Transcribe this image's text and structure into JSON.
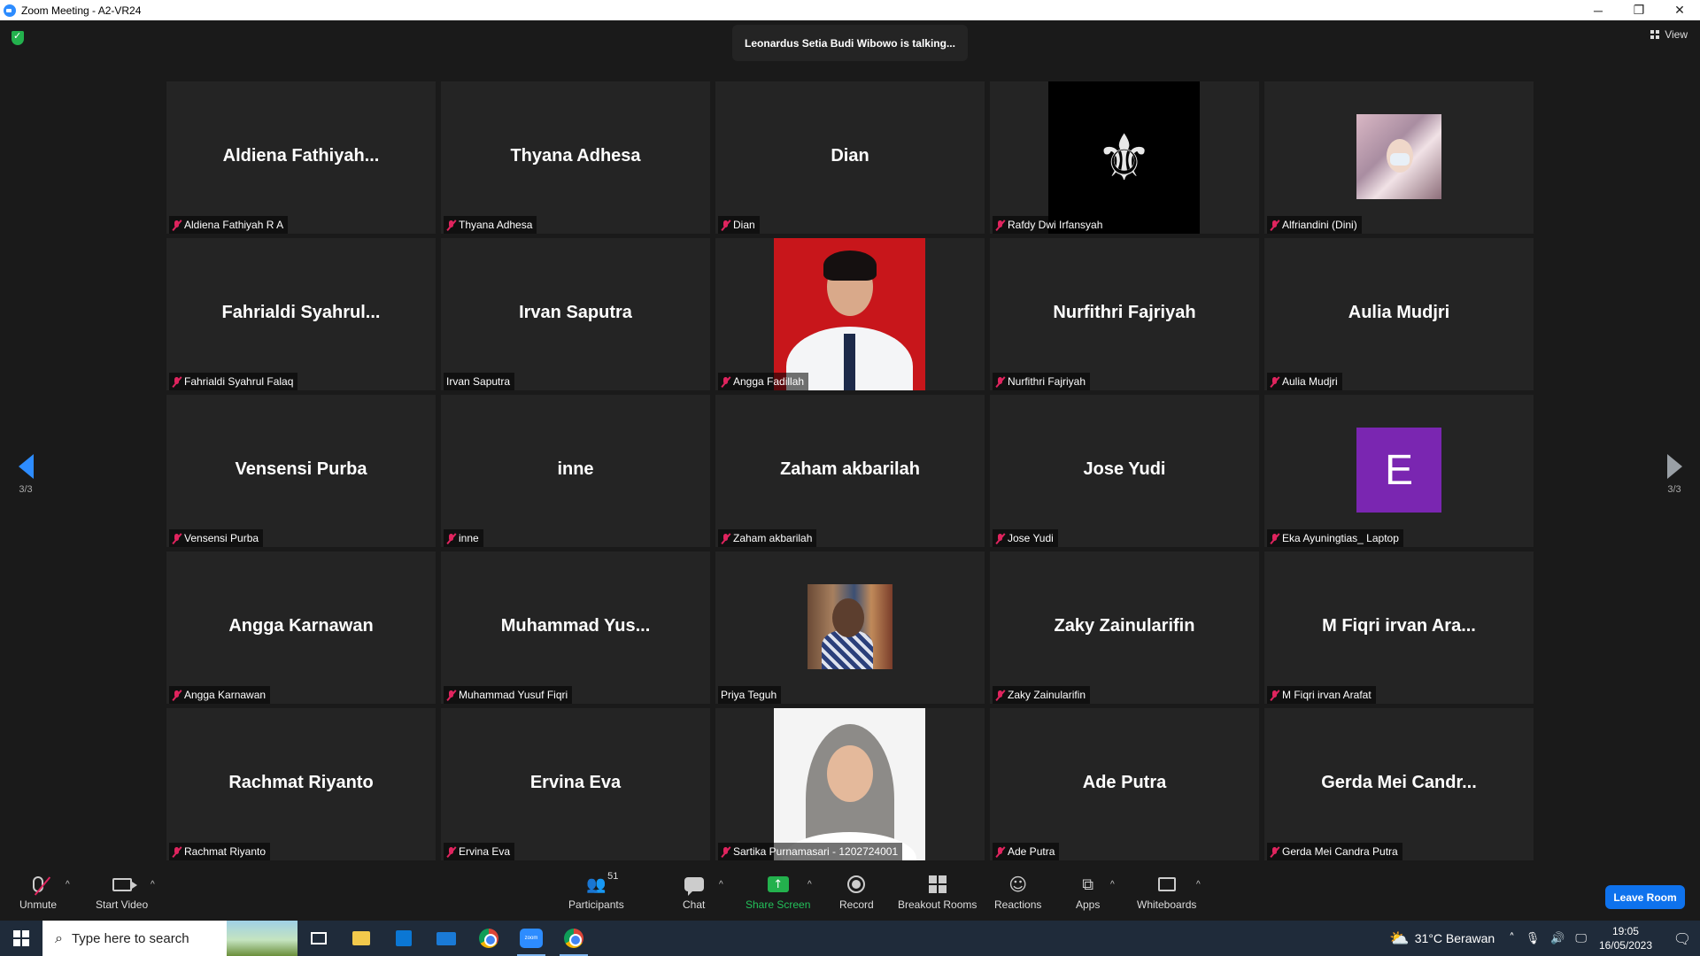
{
  "window": {
    "title": "Zoom Meeting - A2-VR24",
    "controls": [
      "─",
      "❐",
      "✕"
    ]
  },
  "meeting": {
    "talking": "Leonardus Setia Budi Wibowo is talking...",
    "view_label": "View",
    "page_left": "3/3",
    "page_right": "3/3"
  },
  "tiles": [
    {
      "big": "Aldiena  Fathiyah...",
      "label": "Aldiena Fathiyah R A",
      "muted": true
    },
    {
      "big": "Thyana Adhesa",
      "label": "Thyana Adhesa",
      "muted": true
    },
    {
      "big": "Dian",
      "label": "Dian",
      "muted": true
    },
    {
      "big": "",
      "label": "Rafdy Dwi Irfansyah",
      "muted": true,
      "media": "logo"
    },
    {
      "big": "",
      "label": "Alfriandini (Dini)",
      "muted": true,
      "media": "avatar-photo"
    },
    {
      "big": "Fahrialdi  Syahrul...",
      "label": "Fahrialdi Syahrul Falaq",
      "muted": true
    },
    {
      "big": "Irvan Saputra",
      "label": "Irvan Saputra",
      "muted": false
    },
    {
      "big": "",
      "label": "Angga Fadillah",
      "muted": true,
      "media": "red-portrait"
    },
    {
      "big": "Nurfithri Fajriyah",
      "label": "Nurfithri Fajriyah",
      "muted": true
    },
    {
      "big": "Aulia Mudjri",
      "label": "Aulia Mudjri",
      "muted": true
    },
    {
      "big": "Vensensi Purba",
      "label": "Vensensi Purba",
      "muted": true
    },
    {
      "big": "inne",
      "label": "inne",
      "muted": true
    },
    {
      "big": "Zaham akbarilah",
      "label": "Zaham akbarilah",
      "muted": true
    },
    {
      "big": "Jose Yudi",
      "label": "Jose Yudi",
      "muted": true
    },
    {
      "big": "",
      "label": "Eka Ayuningtias_ Laptop",
      "muted": true,
      "media": "letter-avatar",
      "letter": "E"
    },
    {
      "big": "Angga Karnawan",
      "label": "Angga Karnawan",
      "muted": true
    },
    {
      "big": "Muhammad  Yus...",
      "label": "Muhammad Yusuf Fiqri",
      "muted": true
    },
    {
      "big": "",
      "label": "Priya Teguh",
      "muted": false,
      "media": "small-photo"
    },
    {
      "big": "Zaky Zainularifin",
      "label": "Zaky Zainularifin",
      "muted": true
    },
    {
      "big": "M Fiqri irvan Ara...",
      "label": "M Fiqri irvan Arafat",
      "muted": true
    },
    {
      "big": "Rachmat Riyanto",
      "label": "Rachmat Riyanto",
      "muted": true
    },
    {
      "big": "Ervina Eva",
      "label": "Ervina Eva",
      "muted": true
    },
    {
      "big": "",
      "label": "Sartika Purnamasari - 1202724001",
      "muted": true,
      "media": "hijab-portrait"
    },
    {
      "big": "Ade Putra",
      "label": "Ade Putra",
      "muted": true
    },
    {
      "big": "Gerda Mei Candr...",
      "label": "Gerda Mei Candra Putra",
      "muted": true
    }
  ],
  "toolbar": {
    "unmute": "Unmute",
    "start_video": "Start Video",
    "participants": "Participants",
    "participants_count": "51",
    "chat": "Chat",
    "share_screen": "Share Screen",
    "record": "Record",
    "breakout_rooms": "Breakout Rooms",
    "reactions": "Reactions",
    "apps": "Apps",
    "whiteboards": "Whiteboards",
    "leave": "Leave Room",
    "share_color": "#23b14d",
    "leave_color": "#0e72ed"
  },
  "taskbar": {
    "search_placeholder": "Type here to search",
    "zoom_icon_text": "zoom",
    "weather": "31°C  Berawan",
    "time": "19:05",
    "date": "16/05/2023"
  }
}
